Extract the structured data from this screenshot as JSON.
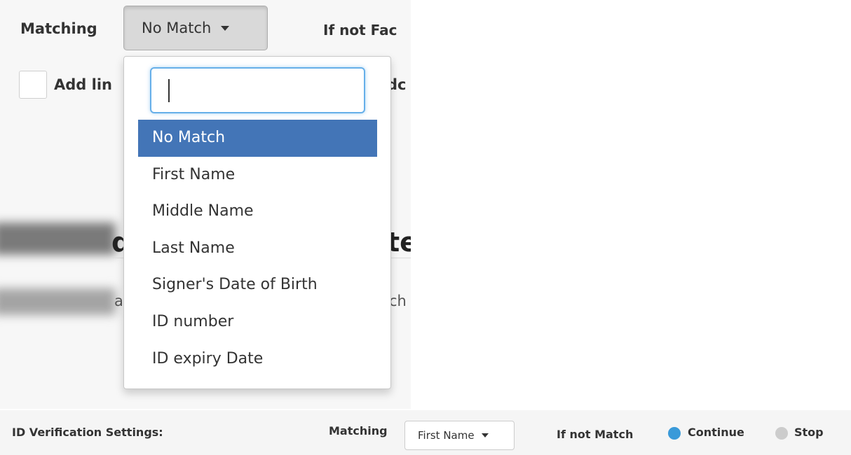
{
  "top_section": {
    "matching_label": "Matching",
    "matching_button_value": "No Match",
    "if_not_label_partial": "If not Fac",
    "add_link_label_partial": "Add lin",
    "add_right_partial": "dc",
    "background_text_left": "d",
    "background_text_right": "te",
    "background_line_left": "a",
    "background_line_right": "ch"
  },
  "dropdown": {
    "search_value": "",
    "options": [
      {
        "label": "No Match",
        "selected": true
      },
      {
        "label": "First Name",
        "selected": false
      },
      {
        "label": "Middle Name",
        "selected": false
      },
      {
        "label": "Last Name",
        "selected": false
      },
      {
        "label": "Signer's Date of Birth",
        "selected": false
      },
      {
        "label": "ID number",
        "selected": false
      },
      {
        "label": "ID expiry Date",
        "selected": false
      }
    ]
  },
  "bottom_bar": {
    "title": "ID Verification Settings:",
    "matching_label": "Matching",
    "matching_value": "First Name",
    "if_not_match_label": "If not Match",
    "radio_options": [
      {
        "label": "Continue",
        "selected": true,
        "color": "#3a9ad9"
      },
      {
        "label": "Stop",
        "selected": false,
        "color": "#cccccc"
      }
    ]
  },
  "colors": {
    "selected_option_bg": "#4375b7",
    "search_focus_border": "#66afe9",
    "radio_selected": "#3a9ad9"
  }
}
